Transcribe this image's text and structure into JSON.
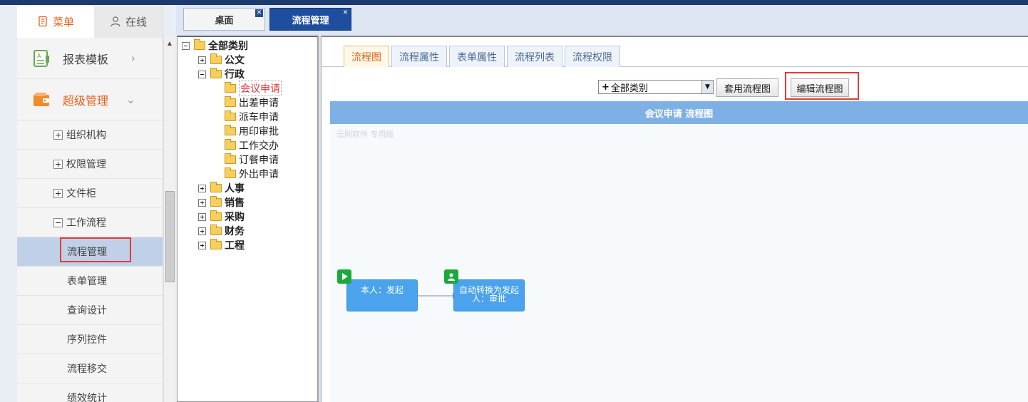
{
  "menu_tabs": [
    {
      "label": "菜单",
      "icon": "document-icon"
    },
    {
      "label": "在线",
      "icon": "user-icon"
    }
  ],
  "menu_groups": [
    {
      "label": "报表模板",
      "icon": "report-icon",
      "expanded": false
    },
    {
      "label": "超级管理",
      "icon": "wallet-icon",
      "expanded": true
    }
  ],
  "sub_items": [
    {
      "label": "组织机构",
      "expanded": false
    },
    {
      "label": "权限管理",
      "expanded": false
    },
    {
      "label": "文件柜",
      "expanded": false
    },
    {
      "label": "工作流程",
      "expanded": true
    }
  ],
  "leaf_items": [
    "流程管理",
    "表单管理",
    "查询设计",
    "序列控件",
    "流程移交",
    "绩效统计"
  ],
  "window_tabs": [
    {
      "label": "桌面",
      "active": false
    },
    {
      "label": "流程管理",
      "active": true
    }
  ],
  "tree": {
    "root": "全部类别",
    "categories": [
      {
        "label": "公文",
        "expanded": false
      },
      {
        "label": "行政",
        "expanded": true,
        "children": [
          "会议申请",
          "出差申请",
          "派车申请",
          "用印审批",
          "工作交办",
          "订餐申请",
          "外出申请"
        ]
      },
      {
        "label": "人事",
        "expanded": false
      },
      {
        "label": "销售",
        "expanded": false
      },
      {
        "label": "采购",
        "expanded": false
      },
      {
        "label": "财务",
        "expanded": false
      },
      {
        "label": "工程",
        "expanded": false
      }
    ],
    "selected": "会议申请"
  },
  "content_tabs": [
    "流程图",
    "流程属性",
    "表单属性",
    "流程列表",
    "流程权限"
  ],
  "active_content_tab": "流程图",
  "toolbar": {
    "category_select": "全部类别",
    "apply_button": "套用流程图",
    "edit_button": "编辑流程图"
  },
  "flow": {
    "title": "会议申请 流程图",
    "watermark": "云网软件 专用版",
    "nodes": [
      {
        "label": "本人：发起",
        "badge": "start-icon"
      },
      {
        "label": "自动转换为发起人：审批",
        "badge": "user-icon"
      }
    ]
  },
  "colors": {
    "accent": "#e8601c",
    "highlight": "#e53935",
    "active_tab": "#1f4e9f",
    "flow_header": "#7fb0e5",
    "node": "#4aa3ec",
    "badge": "#1aaa3a"
  }
}
